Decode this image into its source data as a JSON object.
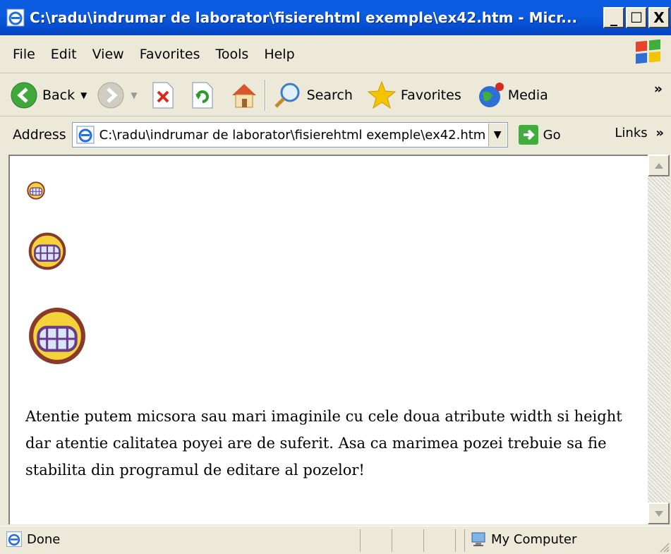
{
  "window": {
    "title": "C:\\radu\\indrumar de laborator\\fisierehtml exemple\\ex42.htm - Micr...",
    "controls": [
      "_",
      "☐",
      "X"
    ]
  },
  "menu": {
    "file": "File",
    "edit": "Edit",
    "view": "View",
    "favorites": "Favorites",
    "tools": "Tools",
    "help": "Help"
  },
  "toolbar": {
    "back": "Back",
    "search": "Search",
    "favorites": "Favorites",
    "media": "Media",
    "chevron": "»"
  },
  "address": {
    "label": "Address",
    "value": "C:\\radu\\indrumar de laborator\\fisierehtml exemple\\ex42.htm",
    "go": "Go",
    "links": "Links",
    "chevron": "»"
  },
  "content": {
    "paragraph": "Atentie putem micsora sau mari imaginile cu cele doua atribute width si height dar atentie calitatea poyei are de suferit. Asa ca marimea pozei trebuie sa fie stabilita din programul de editare al pozelor!"
  },
  "status": {
    "text": "Done",
    "zone": "My Computer"
  },
  "colors": {
    "titlebar": "#0a5ae0",
    "chrome": "#ece9d8",
    "back_arrow": "#3fa83a",
    "stop": "#d62a1e",
    "star": "#f5c400"
  }
}
